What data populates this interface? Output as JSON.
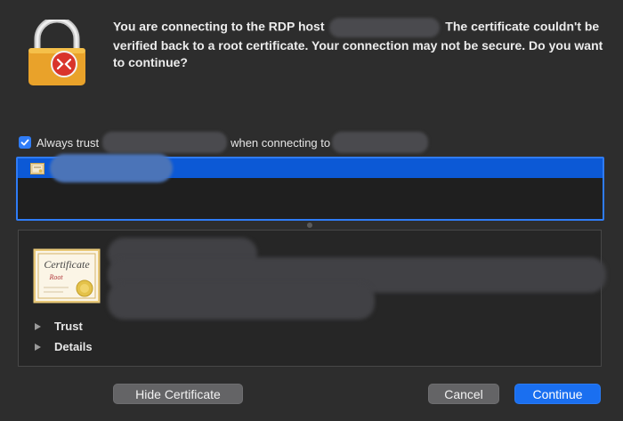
{
  "message": {
    "part1": "You are connecting to the RDP host",
    "part2": "The certificate couldn't be verified back to a root certificate. Your connection may not be secure. Do you want to continue?"
  },
  "trust": {
    "label_prefix": "Always trust",
    "label_middle": "when connecting to",
    "checked": true
  },
  "detail": {
    "cert_icon_title": "Certificate",
    "cert_icon_subtitle": "Root",
    "disclosures": [
      "Trust",
      "Details"
    ]
  },
  "buttons": {
    "hide_certificate": "Hide Certificate",
    "cancel": "Cancel",
    "continue": "Continue"
  },
  "colors": {
    "accent": "#1a6ff0",
    "selection": "#0c59d6",
    "background": "#2d2d2d"
  }
}
